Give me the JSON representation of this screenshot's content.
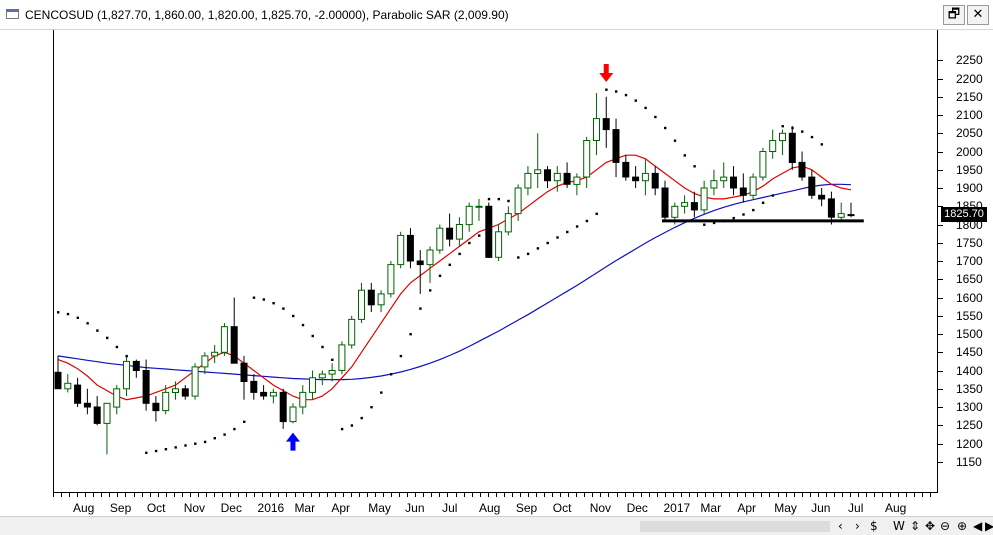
{
  "window": {
    "title": "CENCOSUD (1,827.70, 1,860.00, 1,820.00, 1,825.70, -2.00000), Parabolic SAR (2,009.90)",
    "restore_glyph": "🗗",
    "close_glyph": "✕"
  },
  "chart_data": {
    "type": "candlestick",
    "symbol": "CENCOSUD",
    "indicator": "Parabolic SAR",
    "last_price": "1825.70",
    "y_range": [
      1100,
      2300
    ],
    "y_ticks": [
      "2250",
      "2200",
      "2150",
      "2100",
      "2050",
      "2000",
      "1950",
      "1900",
      "1850",
      "1800",
      "1750",
      "1700",
      "1650",
      "1600",
      "1550",
      "1500",
      "1450",
      "1400",
      "1350",
      "1300",
      "1250",
      "1200",
      "1150"
    ],
    "x_labels": [
      "Aug",
      "Sep",
      "Oct",
      "Nov",
      "Dec",
      "2016",
      "Mar",
      "Apr",
      "May",
      "Jun",
      "Jul",
      "Aug",
      "Sep",
      "Oct",
      "Nov",
      "Dec",
      "2017",
      "Mar",
      "Apr",
      "May",
      "Jun",
      "Jul",
      "Aug"
    ],
    "candles": [
      [
        1395,
        1440,
        1380,
        1350
      ],
      [
        1350,
        1390,
        1340,
        1365
      ],
      [
        1360,
        1380,
        1300,
        1310
      ],
      [
        1310,
        1350,
        1280,
        1300
      ],
      [
        1300,
        1330,
        1250,
        1255
      ],
      [
        1255,
        1290,
        1170,
        1310
      ],
      [
        1300,
        1360,
        1280,
        1350
      ],
      [
        1350,
        1440,
        1330,
        1425
      ],
      [
        1425,
        1430,
        1380,
        1400
      ],
      [
        1400,
        1430,
        1290,
        1310
      ],
      [
        1310,
        1330,
        1260,
        1290
      ],
      [
        1290,
        1360,
        1280,
        1340
      ],
      [
        1340,
        1370,
        1320,
        1350
      ],
      [
        1350,
        1360,
        1320,
        1330
      ],
      [
        1330,
        1420,
        1320,
        1410
      ],
      [
        1410,
        1450,
        1390,
        1440
      ],
      [
        1440,
        1470,
        1420,
        1450
      ],
      [
        1450,
        1530,
        1440,
        1520
      ],
      [
        1520,
        1600,
        1460,
        1420
      ],
      [
        1420,
        1440,
        1320,
        1370
      ],
      [
        1370,
        1390,
        1320,
        1340
      ],
      [
        1340,
        1360,
        1320,
        1330
      ],
      [
        1330,
        1350,
        1310,
        1340
      ],
      [
        1340,
        1350,
        1240,
        1260
      ],
      [
        1260,
        1310,
        1255,
        1300
      ],
      [
        1300,
        1360,
        1280,
        1340
      ],
      [
        1340,
        1400,
        1320,
        1380
      ],
      [
        1380,
        1400,
        1360,
        1390
      ],
      [
        1390,
        1420,
        1370,
        1400
      ],
      [
        1400,
        1480,
        1390,
        1470
      ],
      [
        1470,
        1550,
        1460,
        1540
      ],
      [
        1540,
        1640,
        1530,
        1620
      ],
      [
        1620,
        1640,
        1560,
        1580
      ],
      [
        1580,
        1620,
        1560,
        1610
      ],
      [
        1610,
        1700,
        1600,
        1690
      ],
      [
        1690,
        1780,
        1680,
        1770
      ],
      [
        1770,
        1790,
        1680,
        1700
      ],
      [
        1700,
        1730,
        1610,
        1690
      ],
      [
        1690,
        1740,
        1640,
        1730
      ],
      [
        1730,
        1800,
        1720,
        1790
      ],
      [
        1790,
        1830,
        1740,
        1760
      ],
      [
        1760,
        1820,
        1740,
        1800
      ],
      [
        1800,
        1860,
        1780,
        1850
      ],
      [
        1850,
        1870,
        1810,
        1850
      ],
      [
        1850,
        1860,
        1760,
        1710
      ],
      [
        1710,
        1800,
        1700,
        1780
      ],
      [
        1780,
        1850,
        1770,
        1830
      ],
      [
        1830,
        1910,
        1810,
        1900
      ],
      [
        1900,
        1960,
        1880,
        1940
      ],
      [
        1940,
        2050,
        1900,
        1950
      ],
      [
        1950,
        1960,
        1900,
        1920
      ],
      [
        1920,
        1960,
        1890,
        1940
      ],
      [
        1940,
        1970,
        1900,
        1910
      ],
      [
        1910,
        1940,
        1880,
        1930
      ],
      [
        1930,
        2040,
        1900,
        2030
      ],
      [
        2030,
        2160,
        1990,
        2090
      ],
      [
        2090,
        2150,
        2010,
        2060
      ],
      [
        2060,
        2090,
        1930,
        1970
      ],
      [
        1970,
        1990,
        1920,
        1930
      ],
      [
        1930,
        1960,
        1900,
        1920
      ],
      [
        1920,
        1980,
        1880,
        1940
      ],
      [
        1940,
        1960,
        1880,
        1900
      ],
      [
        1900,
        1920,
        1810,
        1820
      ],
      [
        1820,
        1860,
        1800,
        1850
      ],
      [
        1850,
        1880,
        1830,
        1860
      ],
      [
        1860,
        1890,
        1820,
        1840
      ],
      [
        1840,
        1920,
        1830,
        1900
      ],
      [
        1900,
        1950,
        1880,
        1920
      ],
      [
        1920,
        1970,
        1900,
        1930
      ],
      [
        1930,
        1960,
        1880,
        1900
      ],
      [
        1900,
        1940,
        1860,
        1880
      ],
      [
        1880,
        1940,
        1870,
        1930
      ],
      [
        1930,
        2010,
        1920,
        2000
      ],
      [
        2000,
        2060,
        1980,
        2030
      ],
      [
        2030,
        2060,
        1990,
        2050
      ],
      [
        2050,
        2070,
        1950,
        1970
      ],
      [
        1970,
        2000,
        1920,
        1930
      ],
      [
        1930,
        1950,
        1870,
        1880
      ],
      [
        1880,
        1900,
        1850,
        1870
      ],
      [
        1870,
        1890,
        1800,
        1820
      ],
      [
        1820,
        1860,
        1810,
        1830
      ],
      [
        1827,
        1860,
        1820,
        1826
      ]
    ],
    "sma_red": [
      1430,
      1420,
      1405,
      1385,
      1360,
      1345,
      1330,
      1320,
      1325,
      1330,
      1340,
      1350,
      1360,
      1380,
      1400,
      1420,
      1440,
      1450,
      1440,
      1420,
      1400,
      1380,
      1360,
      1345,
      1330,
      1320,
      1320,
      1330,
      1350,
      1380,
      1410,
      1450,
      1490,
      1530,
      1570,
      1610,
      1640,
      1660,
      1680,
      1700,
      1720,
      1740,
      1760,
      1780,
      1790,
      1800,
      1815,
      1830,
      1850,
      1870,
      1890,
      1905,
      1915,
      1920,
      1930,
      1950,
      1970,
      1980,
      1990,
      1990,
      1980,
      1960,
      1940,
      1920,
      1900,
      1885,
      1875,
      1870,
      1870,
      1875,
      1880,
      1890,
      1905,
      1925,
      1940,
      1955,
      1960,
      1950,
      1930,
      1910,
      1900,
      1895
    ],
    "sma_blue": [
      1440,
      1436,
      1432,
      1428,
      1424,
      1420,
      1417,
      1414,
      1411,
      1408,
      1406,
      1404,
      1402,
      1400,
      1398,
      1396,
      1394,
      1392,
      1390,
      1388,
      1386,
      1384,
      1382,
      1380,
      1378,
      1377,
      1376,
      1375,
      1375,
      1375,
      1376,
      1378,
      1381,
      1385,
      1390,
      1396,
      1403,
      1411,
      1420,
      1430,
      1441,
      1453,
      1466,
      1480,
      1494,
      1508,
      1523,
      1538,
      1553,
      1569,
      1585,
      1601,
      1617,
      1633,
      1650,
      1667,
      1684,
      1701,
      1717,
      1733,
      1749,
      1764,
      1778,
      1792,
      1805,
      1817,
      1828,
      1838,
      1847,
      1855,
      1862,
      1868,
      1874,
      1880,
      1886,
      1892,
      1898,
      1904,
      1908,
      1910,
      1910,
      1909
    ],
    "sar": [
      [
        0,
        1560
      ],
      [
        1,
        1555
      ],
      [
        2,
        1545
      ],
      [
        3,
        1530
      ],
      [
        4,
        1510
      ],
      [
        5,
        1490
      ],
      [
        6,
        1465
      ],
      [
        7,
        1440
      ],
      [
        8,
        1410
      ],
      [
        9,
        1175
      ],
      [
        10,
        1180
      ],
      [
        11,
        1185
      ],
      [
        12,
        1190
      ],
      [
        13,
        1195
      ],
      [
        14,
        1200
      ],
      [
        15,
        1205
      ],
      [
        16,
        1215
      ],
      [
        17,
        1225
      ],
      [
        18,
        1240
      ],
      [
        19,
        1260
      ],
      [
        20,
        1600
      ],
      [
        21,
        1595
      ],
      [
        22,
        1585
      ],
      [
        23,
        1570
      ],
      [
        24,
        1550
      ],
      [
        25,
        1525
      ],
      [
        26,
        1495
      ],
      [
        27,
        1465
      ],
      [
        28,
        1430
      ],
      [
        29,
        1240
      ],
      [
        30,
        1250
      ],
      [
        31,
        1270
      ],
      [
        32,
        1300
      ],
      [
        33,
        1340
      ],
      [
        34,
        1390
      ],
      [
        35,
        1440
      ],
      [
        36,
        1500
      ],
      [
        37,
        1570
      ],
      [
        38,
        1620
      ],
      [
        39,
        1660
      ],
      [
        40,
        1690
      ],
      [
        41,
        1720
      ],
      [
        42,
        1750
      ],
      [
        43,
        1770
      ],
      [
        44,
        1870
      ],
      [
        45,
        1870
      ],
      [
        46,
        1865
      ],
      [
        47,
        1710
      ],
      [
        48,
        1720
      ],
      [
        49,
        1735
      ],
      [
        50,
        1750
      ],
      [
        51,
        1765
      ],
      [
        52,
        1780
      ],
      [
        53,
        1795
      ],
      [
        54,
        1810
      ],
      [
        55,
        1830
      ],
      [
        56,
        2170
      ],
      [
        57,
        2165
      ],
      [
        58,
        2155
      ],
      [
        59,
        2140
      ],
      [
        60,
        2120
      ],
      [
        61,
        2095
      ],
      [
        62,
        2065
      ],
      [
        63,
        2030
      ],
      [
        64,
        1990
      ],
      [
        65,
        1960
      ],
      [
        66,
        1800
      ],
      [
        67,
        1805
      ],
      [
        68,
        1810
      ],
      [
        69,
        1818
      ],
      [
        70,
        1828
      ],
      [
        71,
        1840
      ],
      [
        72,
        1860
      ],
      [
        73,
        1880
      ],
      [
        74,
        2070
      ],
      [
        75,
        2065
      ],
      [
        76,
        2055
      ],
      [
        77,
        2040
      ],
      [
        78,
        2020
      ]
    ],
    "support_line": {
      "y": 1810,
      "from_index": 62,
      "to_index": 82
    },
    "arrows": [
      {
        "index": 24,
        "direction": "up",
        "value": 1205,
        "color": "#0000ff"
      },
      {
        "index": 56,
        "direction": "down",
        "value": 2215,
        "color": "#ff0000"
      }
    ],
    "colors": {
      "up": "#006400",
      "down": "#000000",
      "sma_red": "#e00000",
      "sma_blue": "#1010c0",
      "sar": "#000000"
    }
  },
  "bottom_nav": {
    "buttons": [
      "‹",
      "›",
      "$",
      "W",
      "⇕",
      "✥",
      "⊖",
      "⊕",
      "◀",
      "▶"
    ]
  }
}
